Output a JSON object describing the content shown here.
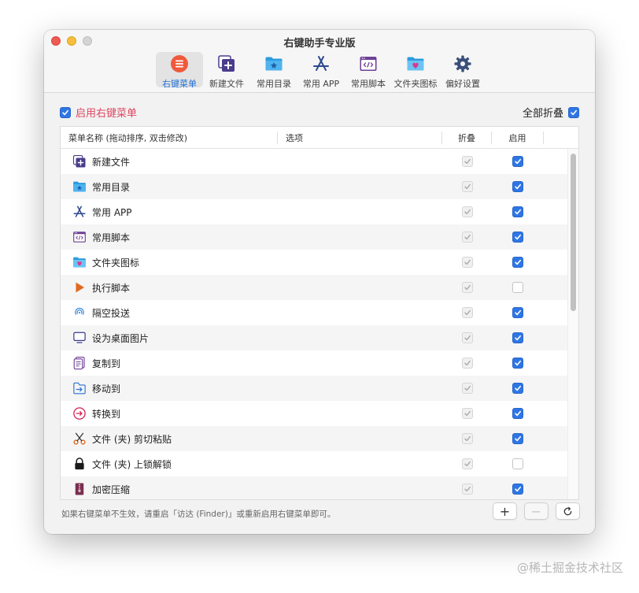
{
  "window": {
    "title": "右键助手专业版"
  },
  "toolbar": [
    {
      "label": "右键菜单",
      "icon": "menu-icon",
      "selected": true
    },
    {
      "label": "新建文件",
      "icon": "new-file-icon",
      "selected": false
    },
    {
      "label": "常用目录",
      "icon": "folder-star-icon",
      "selected": false
    },
    {
      "label": "常用 APP",
      "icon": "app-store-icon",
      "selected": false
    },
    {
      "label": "常用脚本",
      "icon": "script-icon",
      "selected": false
    },
    {
      "label": "文件夹图标",
      "icon": "folder-heart-icon",
      "selected": false
    },
    {
      "label": "偏好设置",
      "icon": "gear-icon",
      "selected": false
    }
  ],
  "enable_menu": {
    "label": "启用右键菜单",
    "checked": true
  },
  "collapse_all": {
    "label": "全部折叠",
    "checked": true
  },
  "table": {
    "headers": {
      "name": "菜单名称 (拖动排序, 双击修改)",
      "options": "选项",
      "collapse": "折叠",
      "enable": "启用"
    },
    "rows": [
      {
        "name": "新建文件",
        "icon": "new-file-icon",
        "collapse": true,
        "enable": true
      },
      {
        "name": "常用目录",
        "icon": "folder-star-icon",
        "collapse": true,
        "enable": true
      },
      {
        "name": "常用 APP",
        "icon": "app-store-icon",
        "collapse": true,
        "enable": true
      },
      {
        "name": "常用脚本",
        "icon": "script-icon",
        "collapse": true,
        "enable": true
      },
      {
        "name": "文件夹图标",
        "icon": "folder-heart-icon",
        "collapse": true,
        "enable": true
      },
      {
        "name": "执行脚本",
        "icon": "play-icon",
        "collapse": true,
        "enable": false
      },
      {
        "name": "隔空投送",
        "icon": "airdrop-icon",
        "collapse": true,
        "enable": true
      },
      {
        "name": "设为桌面图片",
        "icon": "monitor-icon",
        "collapse": true,
        "enable": true
      },
      {
        "name": "复制到",
        "icon": "copy-icon",
        "collapse": true,
        "enable": true
      },
      {
        "name": "移动到",
        "icon": "move-icon",
        "collapse": true,
        "enable": true
      },
      {
        "name": "转换到",
        "icon": "convert-icon",
        "collapse": true,
        "enable": true
      },
      {
        "name": "文件 (夹) 剪切粘贴",
        "icon": "scissors-icon",
        "collapse": true,
        "enable": true
      },
      {
        "name": "文件 (夹) 上锁解锁",
        "icon": "lock-icon",
        "collapse": true,
        "enable": false
      },
      {
        "name": "加密压缩",
        "icon": "archive-icon",
        "collapse": true,
        "enable": true
      }
    ]
  },
  "footer": {
    "note": "如果右键菜单不生效，请重启「访达 (Finder)」或重新启用右键菜单即可。",
    "add_label": "+",
    "remove_label": "−"
  },
  "watermark": "@稀土掘金技术社区",
  "colors": {
    "accent": "#2f76e4",
    "enable_text": "#e04560",
    "selected_tab_text": "#1f6fd6"
  }
}
